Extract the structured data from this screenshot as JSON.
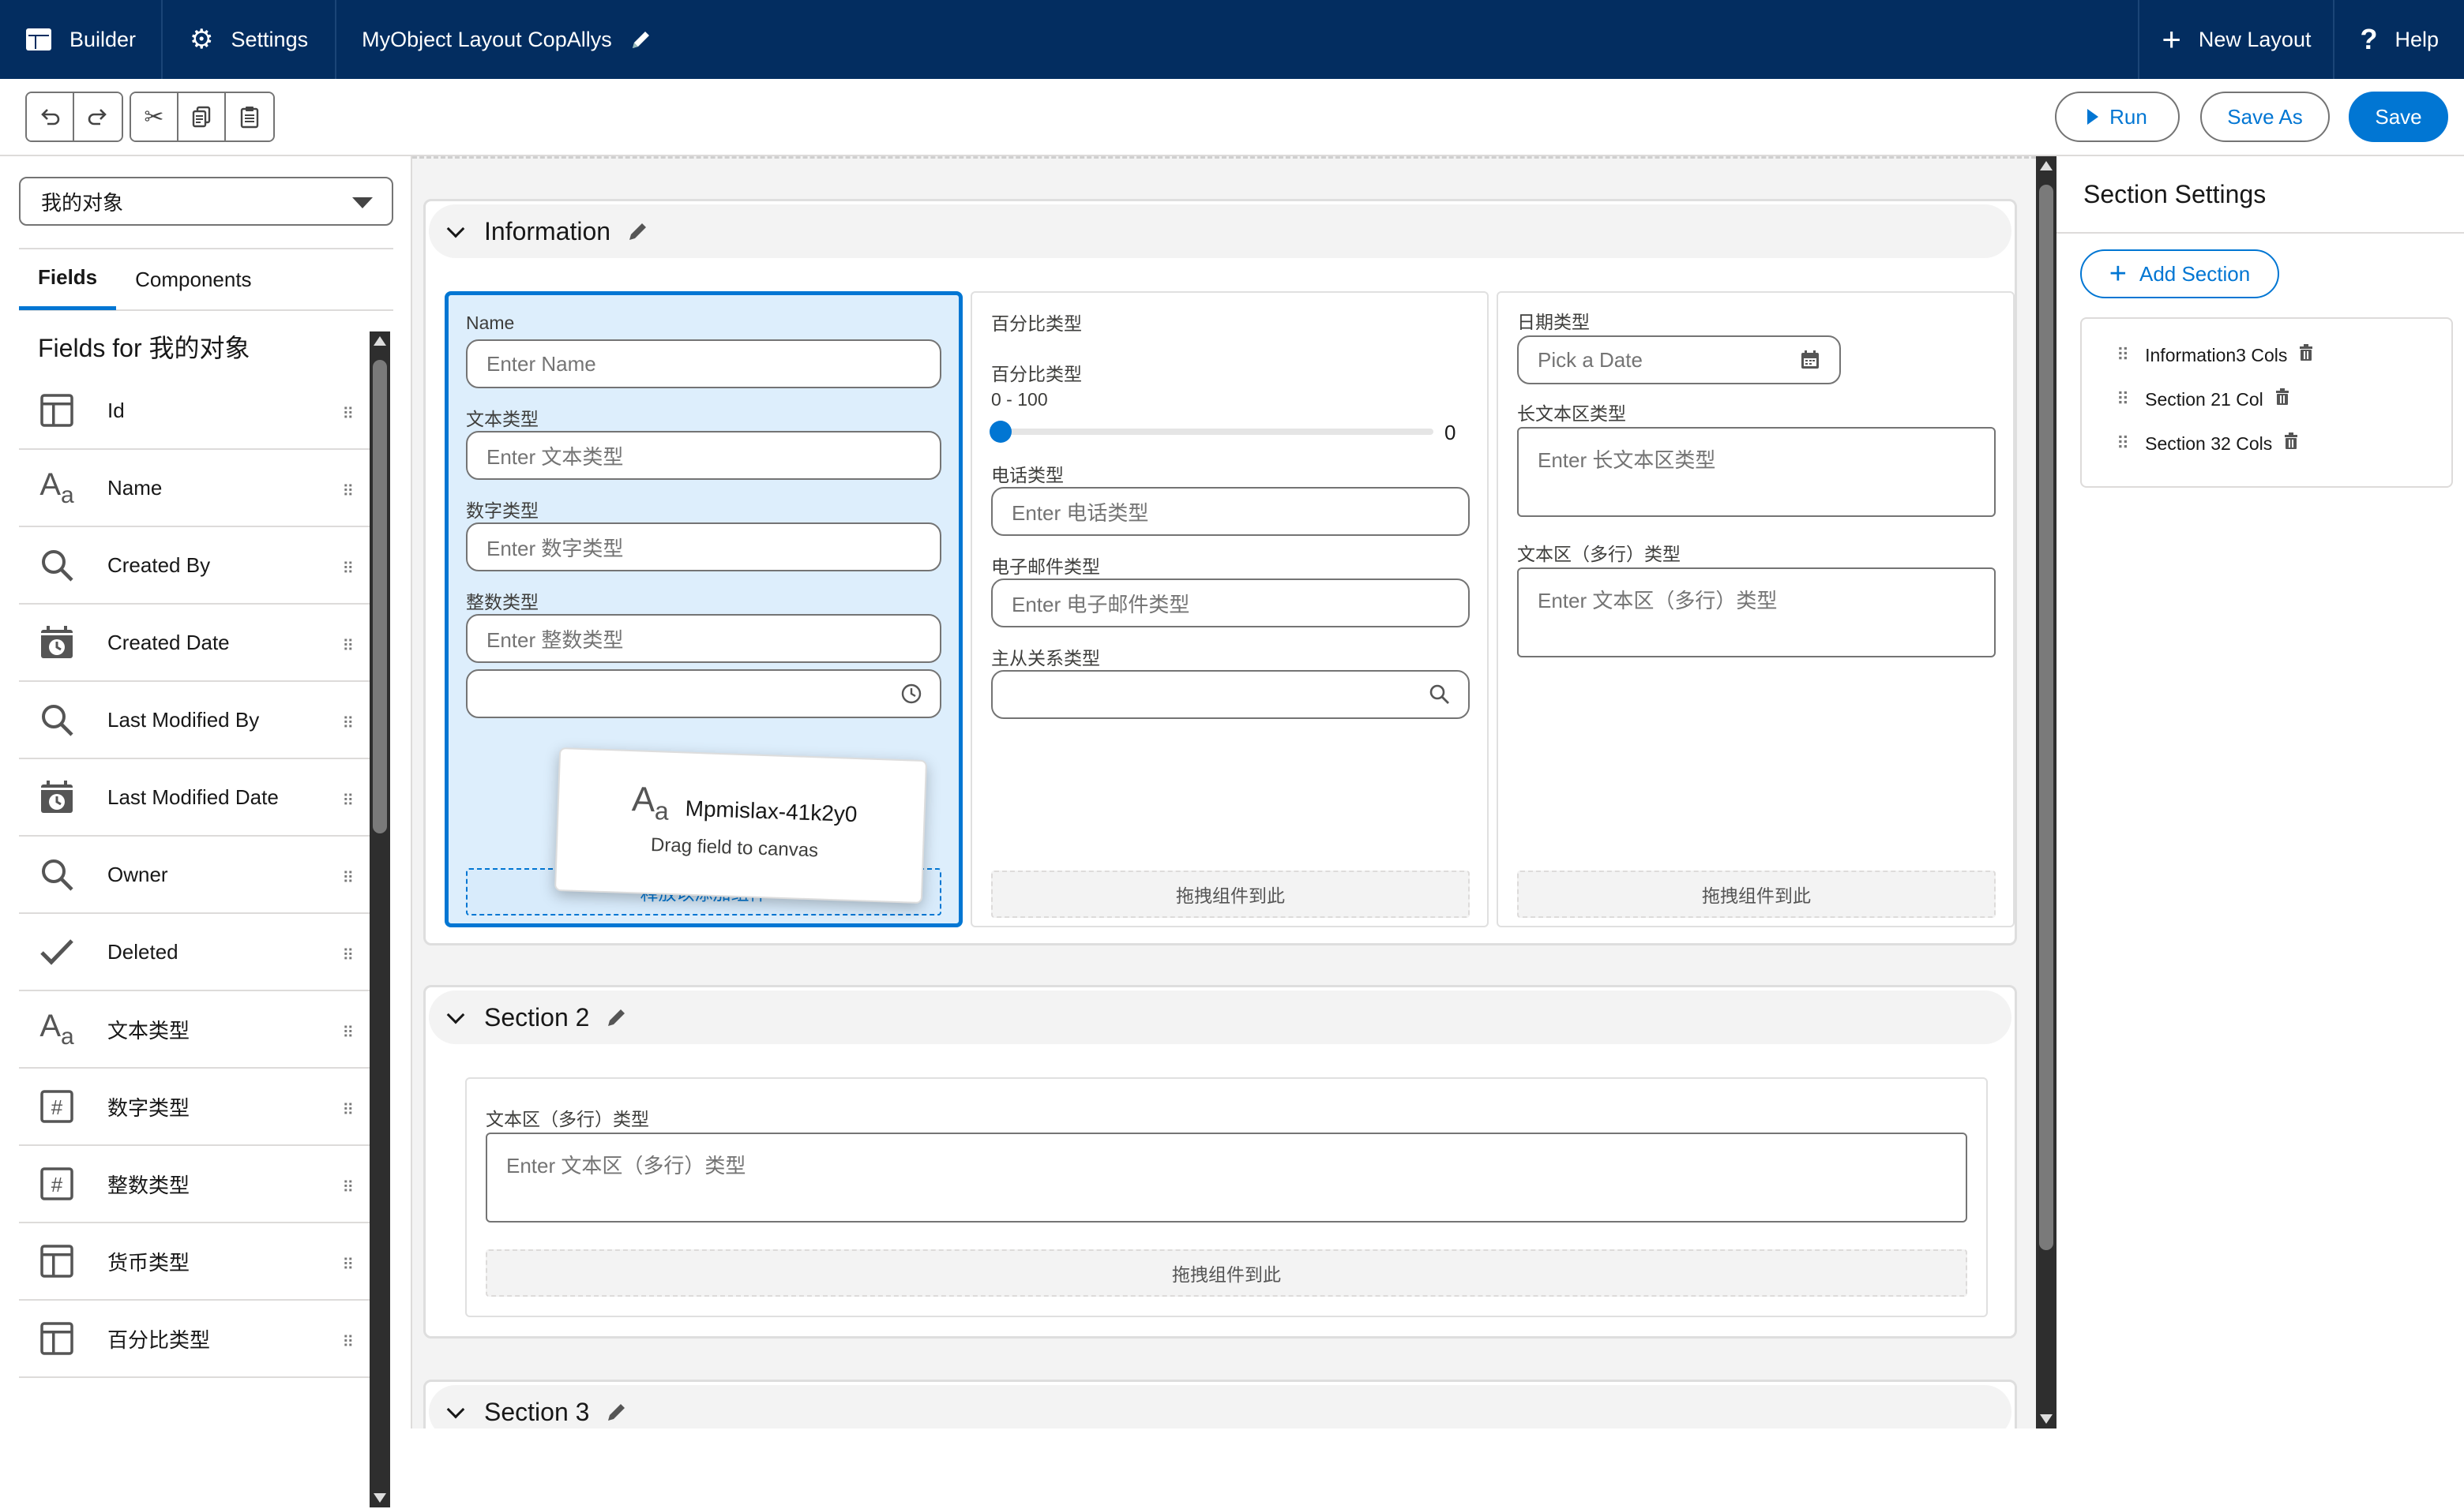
{
  "topbar": {
    "builder": "Builder",
    "settings": "Settings",
    "layout_name": "MyObject Layout CopAllys",
    "new_layout": "New Layout",
    "help": "Help"
  },
  "toolbar": {
    "run": "Run",
    "save_as": "Save As",
    "save": "Save"
  },
  "left": {
    "object_select": "我的对象",
    "tabs": [
      "Fields",
      "Components"
    ],
    "fields_title": "Fields for 我的对象",
    "fields": [
      {
        "label": "Id",
        "icon": "layout-icon"
      },
      {
        "label": "Name",
        "icon": "text-icon"
      },
      {
        "label": "Created By",
        "icon": "search-icon"
      },
      {
        "label": "Created Date",
        "icon": "calendar-clock-icon"
      },
      {
        "label": "Last Modified By",
        "icon": "search-icon"
      },
      {
        "label": "Last Modified Date",
        "icon": "calendar-clock-icon"
      },
      {
        "label": "Owner",
        "icon": "search-icon"
      },
      {
        "label": "Deleted",
        "icon": "check-icon"
      },
      {
        "label": "文本类型",
        "icon": "text-icon"
      },
      {
        "label": "数字类型",
        "icon": "number-icon"
      },
      {
        "label": "整数类型",
        "icon": "number-icon"
      },
      {
        "label": "货币类型",
        "icon": "layout-icon"
      },
      {
        "label": "百分比类型",
        "icon": "layout-icon"
      }
    ]
  },
  "sections": {
    "info": {
      "title": "Information",
      "col1": {
        "name_label": "Name",
        "name_ph": "Enter Name",
        "text_label": "文本类型",
        "text_ph": "Enter 文本类型",
        "num_label": "数字类型",
        "num_ph": "Enter 数字类型",
        "int_label": "整数类型",
        "int_ph": "Enter 整数类型",
        "drop": "释放以添加组件"
      },
      "col2": {
        "header": "百分比类型",
        "pct_label": "百分比类型",
        "range": "0 - 100",
        "value": "0",
        "phone_label": "电话类型",
        "phone_ph": "Enter 电话类型",
        "email_label": "电子邮件类型",
        "email_ph": "Enter 电子邮件类型",
        "lookup_label": "主从关系类型",
        "drop": "拖拽组件到此"
      },
      "col3": {
        "date_label": "日期类型",
        "date_ph": "Pick a Date",
        "longtext_label": "长文本区类型",
        "longtext_ph": "Enter 长文本区类型",
        "textarea_label": "文本区（多行）类型",
        "textarea_ph": "Enter 文本区（多行）类型",
        "drop": "拖拽组件到此"
      }
    },
    "s2": {
      "title": "Section 2",
      "textarea_label": "文本区（多行）类型",
      "textarea_ph": "Enter 文本区（多行）类型",
      "drop": "拖拽组件到此"
    },
    "s3": {
      "title": "Section 3"
    }
  },
  "drag_card": {
    "field": "Mpmislax-41k2y0",
    "hint": "Drag field to canvas"
  },
  "right": {
    "title": "Section Settings",
    "add_section": "Add Section",
    "items": [
      "Information3 Cols",
      "Section 21 Col",
      "Section 32 Cols"
    ]
  },
  "colors": {
    "nav": "#032d60",
    "brand": "#0176d3",
    "selected_bg": "#ddeefc"
  }
}
